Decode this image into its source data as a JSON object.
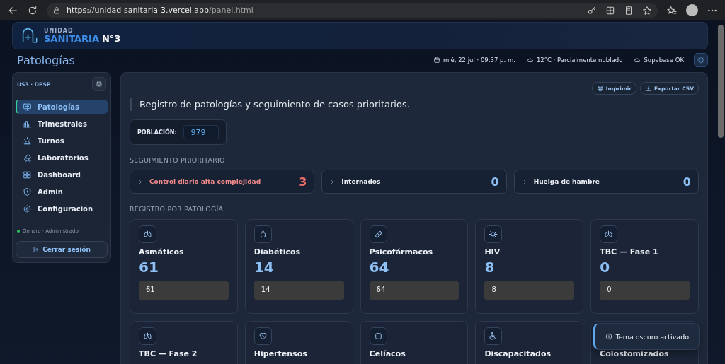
{
  "browser": {
    "url_host": "https://unidad-sanitaria-3.vercel.app",
    "url_path": "/panel.html"
  },
  "brand": {
    "top": "UNIDAD",
    "name": "SANITARIA",
    "number": "N°3"
  },
  "page_title": "Patologías",
  "status": {
    "date": "mié, 22 jul · 09:37 p. m.",
    "weather": "12°C · Parcialmente nublado",
    "database": "Supabase OK"
  },
  "sidebar": {
    "code": "US3 · DPSP",
    "items": [
      {
        "label": "Patologías",
        "selected": true
      },
      {
        "label": "Trimestrales",
        "selected": false
      },
      {
        "label": "Turnos",
        "selected": false
      },
      {
        "label": "Laboratorios",
        "selected": false
      },
      {
        "label": "Dashboard",
        "selected": false
      },
      {
        "label": "Admin",
        "selected": false
      },
      {
        "label": "Configuración",
        "selected": false
      }
    ],
    "user": "Genaro · Administrador",
    "user_online": true,
    "logout": "Cerrar sesión"
  },
  "main": {
    "actions": [
      "Imprimir",
      "Exportar CSV"
    ],
    "subtitle": "Registro de patologías y seguimiento de casos prioritarios.",
    "population": {
      "label": "POBLACIÓN:",
      "value": "979"
    },
    "priority_title": "SEGUIMIENTO PRIORITARIO",
    "priority": [
      {
        "label": "Control diario alta complejidad",
        "count": "3",
        "alert": true
      },
      {
        "label": "Internados",
        "count": "0",
        "alert": false
      },
      {
        "label": "Huelga de hambre",
        "count": "0",
        "alert": false
      }
    ],
    "registry_title": "REGISTRO POR PATOLOGÍA",
    "pathologies": [
      {
        "name": "Asmáticos",
        "count": "61",
        "value": "61"
      },
      {
        "name": "Diabéticos",
        "count": "14",
        "value": "14"
      },
      {
        "name": "Psicofármacos",
        "count": "64",
        "value": "64"
      },
      {
        "name": "HIV",
        "count": "8",
        "value": "8"
      },
      {
        "name": "TBC — Fase 1",
        "count": "0",
        "value": "0"
      },
      {
        "name": "TBC — Fase 2"
      },
      {
        "name": "Hipertensos"
      },
      {
        "name": "Celíacos"
      },
      {
        "name": "Discapacitados"
      },
      {
        "name": "Colostomizados"
      }
    ]
  },
  "toast": "Tema oscuro activado"
}
